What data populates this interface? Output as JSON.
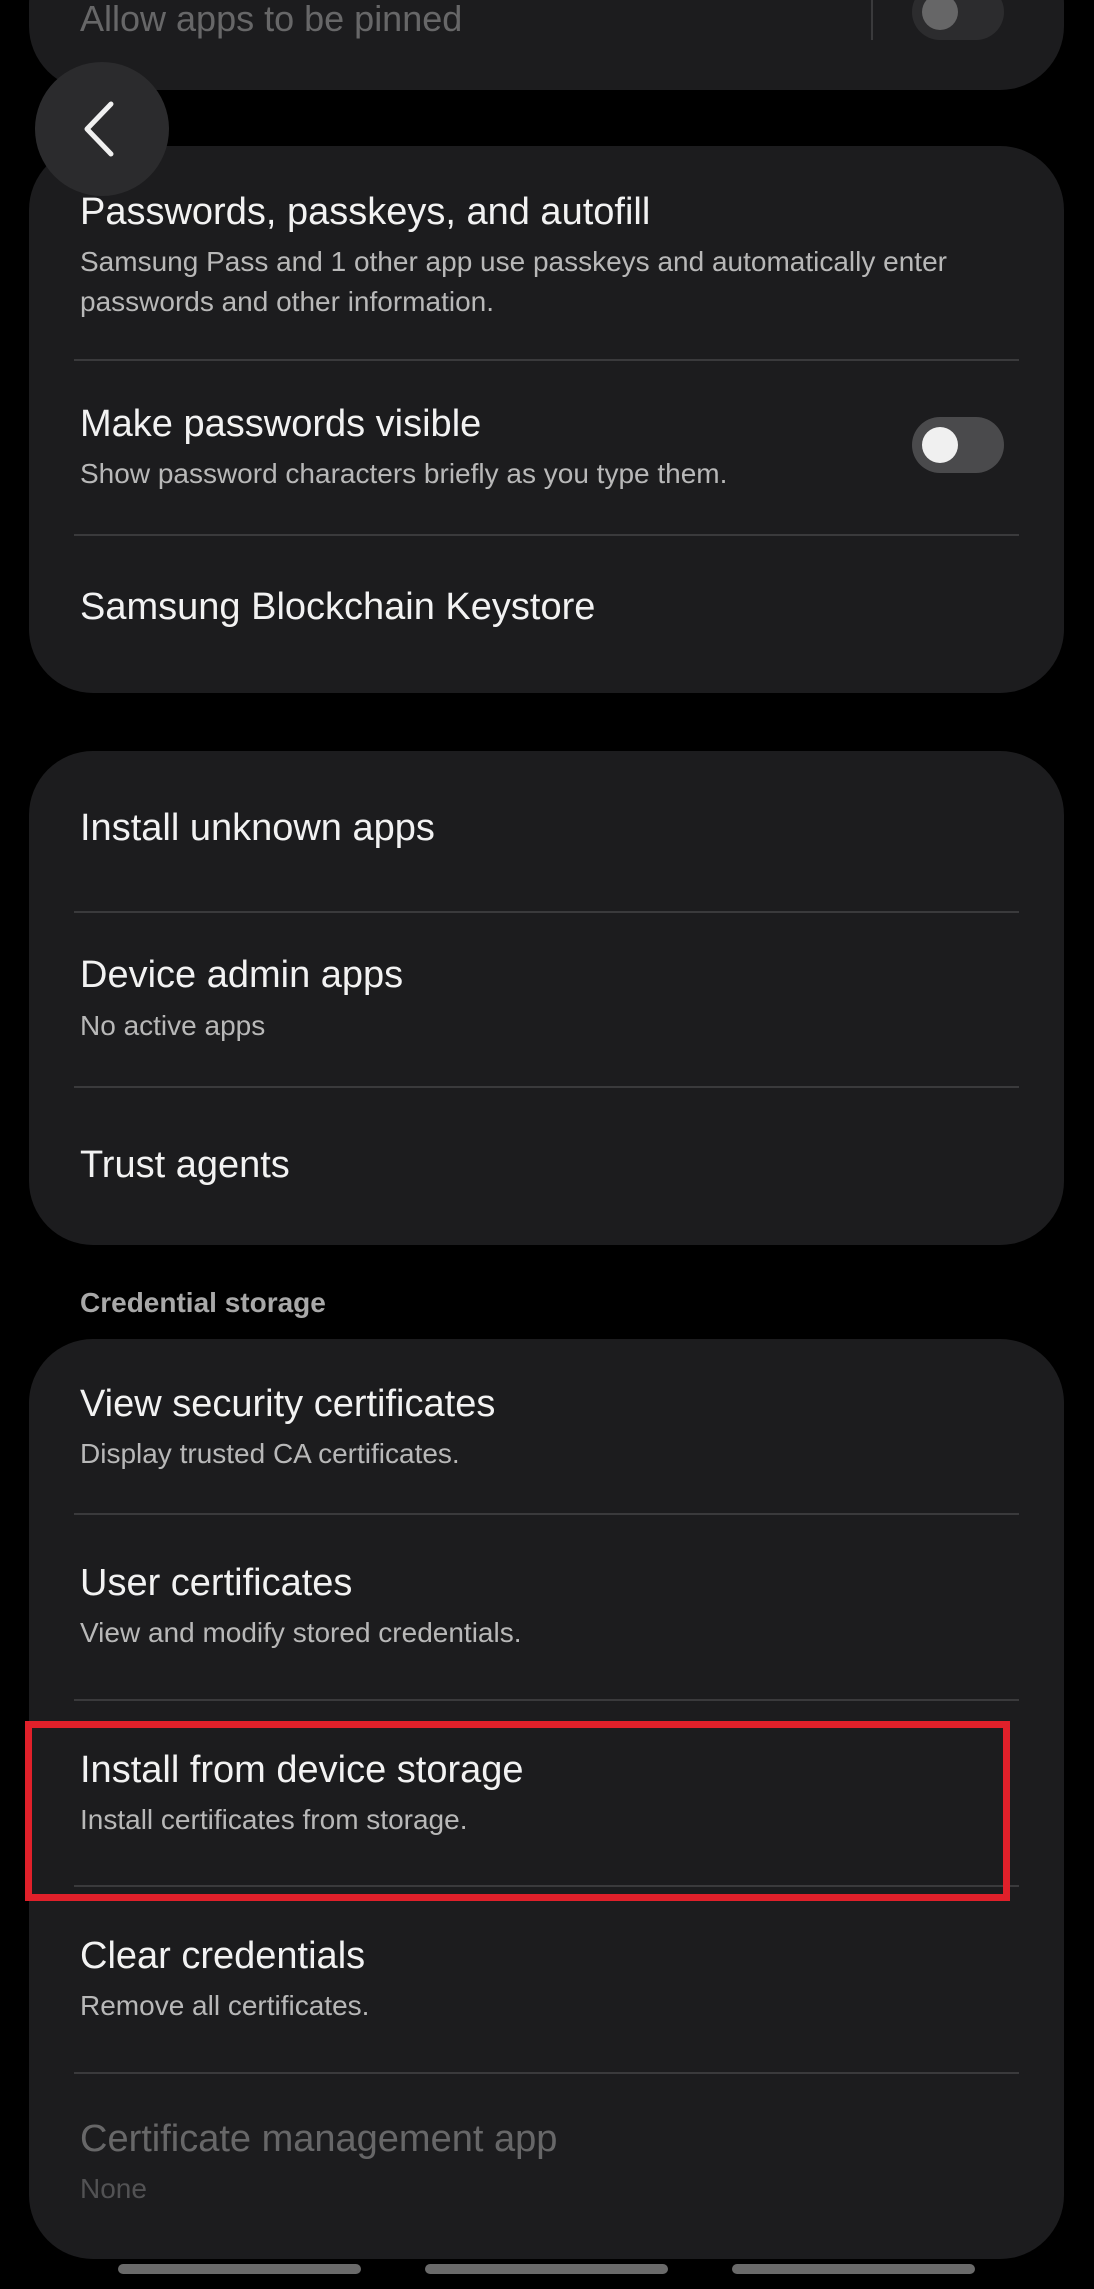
{
  "top_partial": {
    "title": "Allow apps to be pinned"
  },
  "back_button": {
    "icon": "chevron-left-icon"
  },
  "group1": {
    "items": [
      {
        "title": "Passwords, passkeys, and autofill",
        "subtitle_line1": "Samsung Pass and 1 other app use passkeys and automatically enter",
        "subtitle_line2": "passwords and other information."
      },
      {
        "title": "Make passwords visible",
        "subtitle": "Show password characters briefly as you type them.",
        "toggle_on": false
      },
      {
        "title": "Samsung Blockchain Keystore"
      }
    ]
  },
  "group2": {
    "items": [
      {
        "title": "Install unknown apps"
      },
      {
        "title": "Device admin apps",
        "subtitle": "No active apps"
      },
      {
        "title": "Trust agents"
      }
    ]
  },
  "credential_storage": {
    "header": "Credential storage",
    "items": [
      {
        "title": "View security certificates",
        "subtitle": "Display trusted CA certificates."
      },
      {
        "title": "User certificates",
        "subtitle": "View and modify stored credentials."
      },
      {
        "title": "Install from device storage",
        "subtitle": "Install certificates from storage.",
        "highlighted": true
      },
      {
        "title": "Clear credentials",
        "subtitle": "Remove all certificates."
      },
      {
        "title": "Certificate management app",
        "subtitle": "None",
        "disabled": true
      }
    ]
  },
  "colors": {
    "background": "#000000",
    "card": "#1c1c1e",
    "highlight": "#e0202a"
  }
}
